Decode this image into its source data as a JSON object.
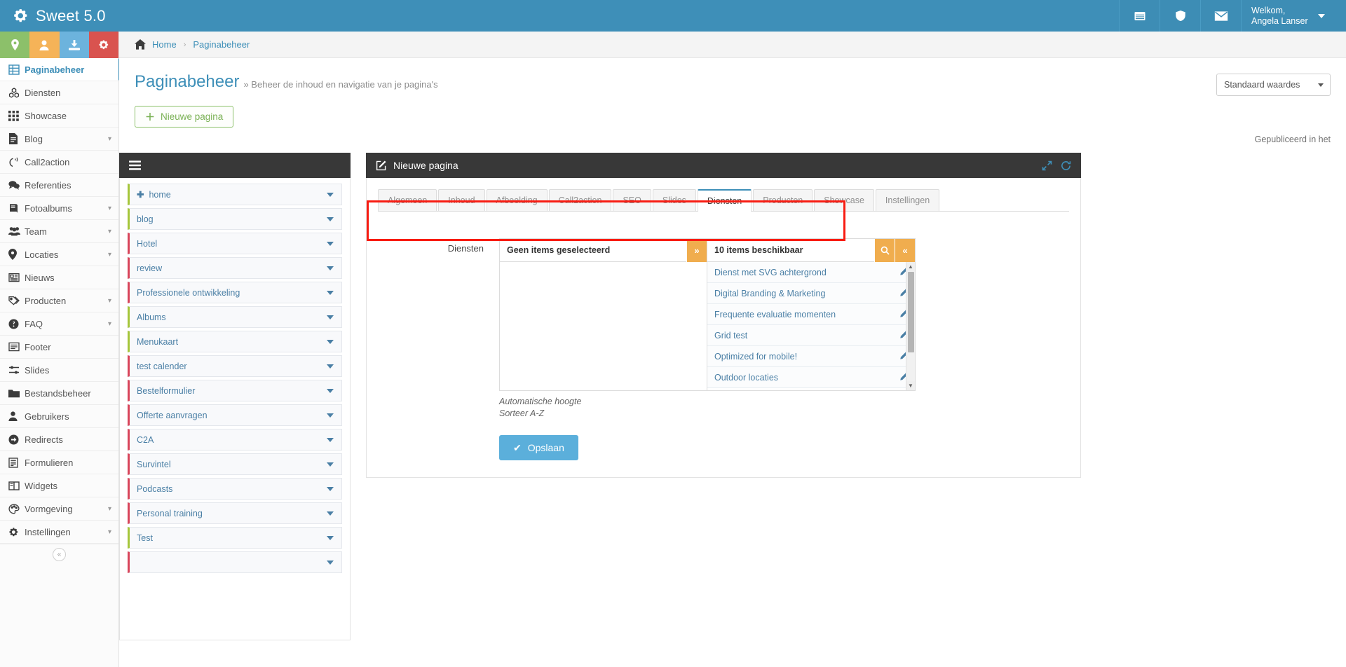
{
  "topbar": {
    "brand": "Sweet 5.0",
    "brand_icon": "gears-icon",
    "buttons": [
      {
        "name": "calendar-icon",
        "glyph": "☰"
      },
      {
        "name": "shield-icon",
        "glyph": "⬡"
      },
      {
        "name": "envelope-icon",
        "glyph": "✉"
      }
    ],
    "user": {
      "greeting": "Welkom,",
      "name": "Angela Lanser"
    }
  },
  "quickbar": [
    {
      "name": "location-quick-button",
      "icon": "map-marker-icon",
      "color": "#8cc06a"
    },
    {
      "name": "user-quick-button",
      "icon": "user-icon",
      "color": "#f5b358"
    },
    {
      "name": "download-quick-button",
      "icon": "download-icon",
      "color": "#6cb3dd"
    },
    {
      "name": "settings-quick-button",
      "icon": "gears-icon",
      "color": "#d9534f"
    }
  ],
  "sidebar": {
    "items": [
      {
        "label": "Paginabeheer",
        "icon": "table-icon",
        "active": true,
        "chevron": false
      },
      {
        "label": "Diensten",
        "icon": "cubes-icon",
        "active": false,
        "chevron": false
      },
      {
        "label": "Showcase",
        "icon": "grid-icon",
        "active": false,
        "chevron": false
      },
      {
        "label": "Blog",
        "icon": "document-icon",
        "active": false,
        "chevron": true
      },
      {
        "label": "Call2action",
        "icon": "megaphone-icon",
        "active": false,
        "chevron": false
      },
      {
        "label": "Referenties",
        "icon": "comments-icon",
        "active": false,
        "chevron": false
      },
      {
        "label": "Fotoalbums",
        "icon": "book-icon",
        "active": false,
        "chevron": true
      },
      {
        "label": "Team",
        "icon": "users-icon",
        "active": false,
        "chevron": true
      },
      {
        "label": "Locaties",
        "icon": "map-marker-icon",
        "active": false,
        "chevron": true
      },
      {
        "label": "Nieuws",
        "icon": "newspaper-icon",
        "active": false,
        "chevron": false
      },
      {
        "label": "Producten",
        "icon": "tags-icon",
        "active": false,
        "chevron": true
      },
      {
        "label": "FAQ",
        "icon": "question-icon",
        "active": false,
        "chevron": true
      },
      {
        "label": "Footer",
        "icon": "list-icon",
        "active": false,
        "chevron": false
      },
      {
        "label": "Slides",
        "icon": "sliders-icon",
        "active": false,
        "chevron": false
      },
      {
        "label": "Bestandsbeheer",
        "icon": "folder-icon",
        "active": false,
        "chevron": false
      },
      {
        "label": "Gebruikers",
        "icon": "user-icon",
        "active": false,
        "chevron": false
      },
      {
        "label": "Redirects",
        "icon": "arrow-circle-icon",
        "active": false,
        "chevron": false
      },
      {
        "label": "Formulieren",
        "icon": "form-icon",
        "active": false,
        "chevron": false
      },
      {
        "label": "Widgets",
        "icon": "columns-icon",
        "active": false,
        "chevron": false
      },
      {
        "label": "Vormgeving",
        "icon": "palette-icon",
        "active": false,
        "chevron": true
      },
      {
        "label": "Instellingen",
        "icon": "gear-icon",
        "active": false,
        "chevron": true
      }
    ],
    "collapse_glyph": "«"
  },
  "breadcrumb": {
    "home_icon": "home-icon",
    "home": "Home",
    "separator": "›",
    "current": "Paginabeheer"
  },
  "page": {
    "title": "Paginabeheer",
    "subtitle": "» Beheer de inhoud en navigatie van je pagina's",
    "select_value": "Standaard waardes",
    "new_page_button": "Nieuwe pagina",
    "new_page_plus": "＋",
    "published_note": "Gepubliceerd in het"
  },
  "menu_panel": {
    "hamburger_icon": "hamburger-icon",
    "rows": [
      {
        "label": "home",
        "color": "green",
        "plus": true
      },
      {
        "label": "blog",
        "color": "green",
        "plus": false
      },
      {
        "label": "Hotel",
        "color": "red",
        "plus": false
      },
      {
        "label": "review",
        "color": "red",
        "plus": false
      },
      {
        "label": "Professionele ontwikkeling",
        "color": "red",
        "plus": false
      },
      {
        "label": "Albums",
        "color": "green",
        "plus": false
      },
      {
        "label": "Menukaart",
        "color": "green",
        "plus": false
      },
      {
        "label": "test calender",
        "color": "red",
        "plus": false
      },
      {
        "label": "Bestelformulier",
        "color": "red",
        "plus": false
      },
      {
        "label": "Offerte aanvragen",
        "color": "red",
        "plus": false
      },
      {
        "label": "C2A",
        "color": "red",
        "plus": false
      },
      {
        "label": "Survintel",
        "color": "red",
        "plus": false
      },
      {
        "label": "Podcasts",
        "color": "red",
        "plus": false
      },
      {
        "label": "Personal training",
        "color": "red",
        "plus": false
      },
      {
        "label": "Test",
        "color": "green",
        "plus": false
      },
      {
        "label": "",
        "color": "red",
        "plus": false
      }
    ]
  },
  "editor": {
    "header_title": "Nieuwe pagina",
    "header_icon": "edit-icon",
    "expand_icon": "expand-icon",
    "refresh_icon": "refresh-icon",
    "tabs": [
      {
        "label": "Algemeen",
        "active": false
      },
      {
        "label": "Inhoud",
        "active": false
      },
      {
        "label": "Afbeelding",
        "active": false
      },
      {
        "label": "Call2action",
        "active": false
      },
      {
        "label": "SEO",
        "active": false
      },
      {
        "label": "Slides",
        "active": false
      },
      {
        "label": "Diensten",
        "active": true
      },
      {
        "label": "Producten",
        "active": false
      },
      {
        "label": "Showcase",
        "active": false
      },
      {
        "label": "Instellingen",
        "active": false
      }
    ],
    "field_label": "Diensten",
    "selected_panel": {
      "header": "Geen items geselecteerd",
      "move_button_glyph": "»",
      "items": []
    },
    "available_panel": {
      "header": "10 items beschikbaar",
      "search_icon": "search-icon",
      "collapse_glyph": "«",
      "items": [
        "Dienst met SVG achtergrond",
        "Digital Branding & Marketing",
        "Frequente evaluatie momenten",
        "Grid test",
        "Optimized for mobile!",
        "Outdoor locaties"
      ],
      "edit_icon": "pencil-icon"
    },
    "hints": [
      "Automatische hoogte",
      "Sorteer A-Z"
    ],
    "save_button": "Opslaan",
    "save_check": "✔"
  },
  "colors": {
    "brand_blue": "#3e8fb8",
    "accent_orange": "#f0ad4e",
    "green": "#8cc06a",
    "red": "#d9534f",
    "highlight_red": "#f81c12",
    "dark_panel": "#383838",
    "menu_green": "#a5c63b",
    "menu_red": "#d9455b",
    "save_blue": "#5bafdb"
  }
}
